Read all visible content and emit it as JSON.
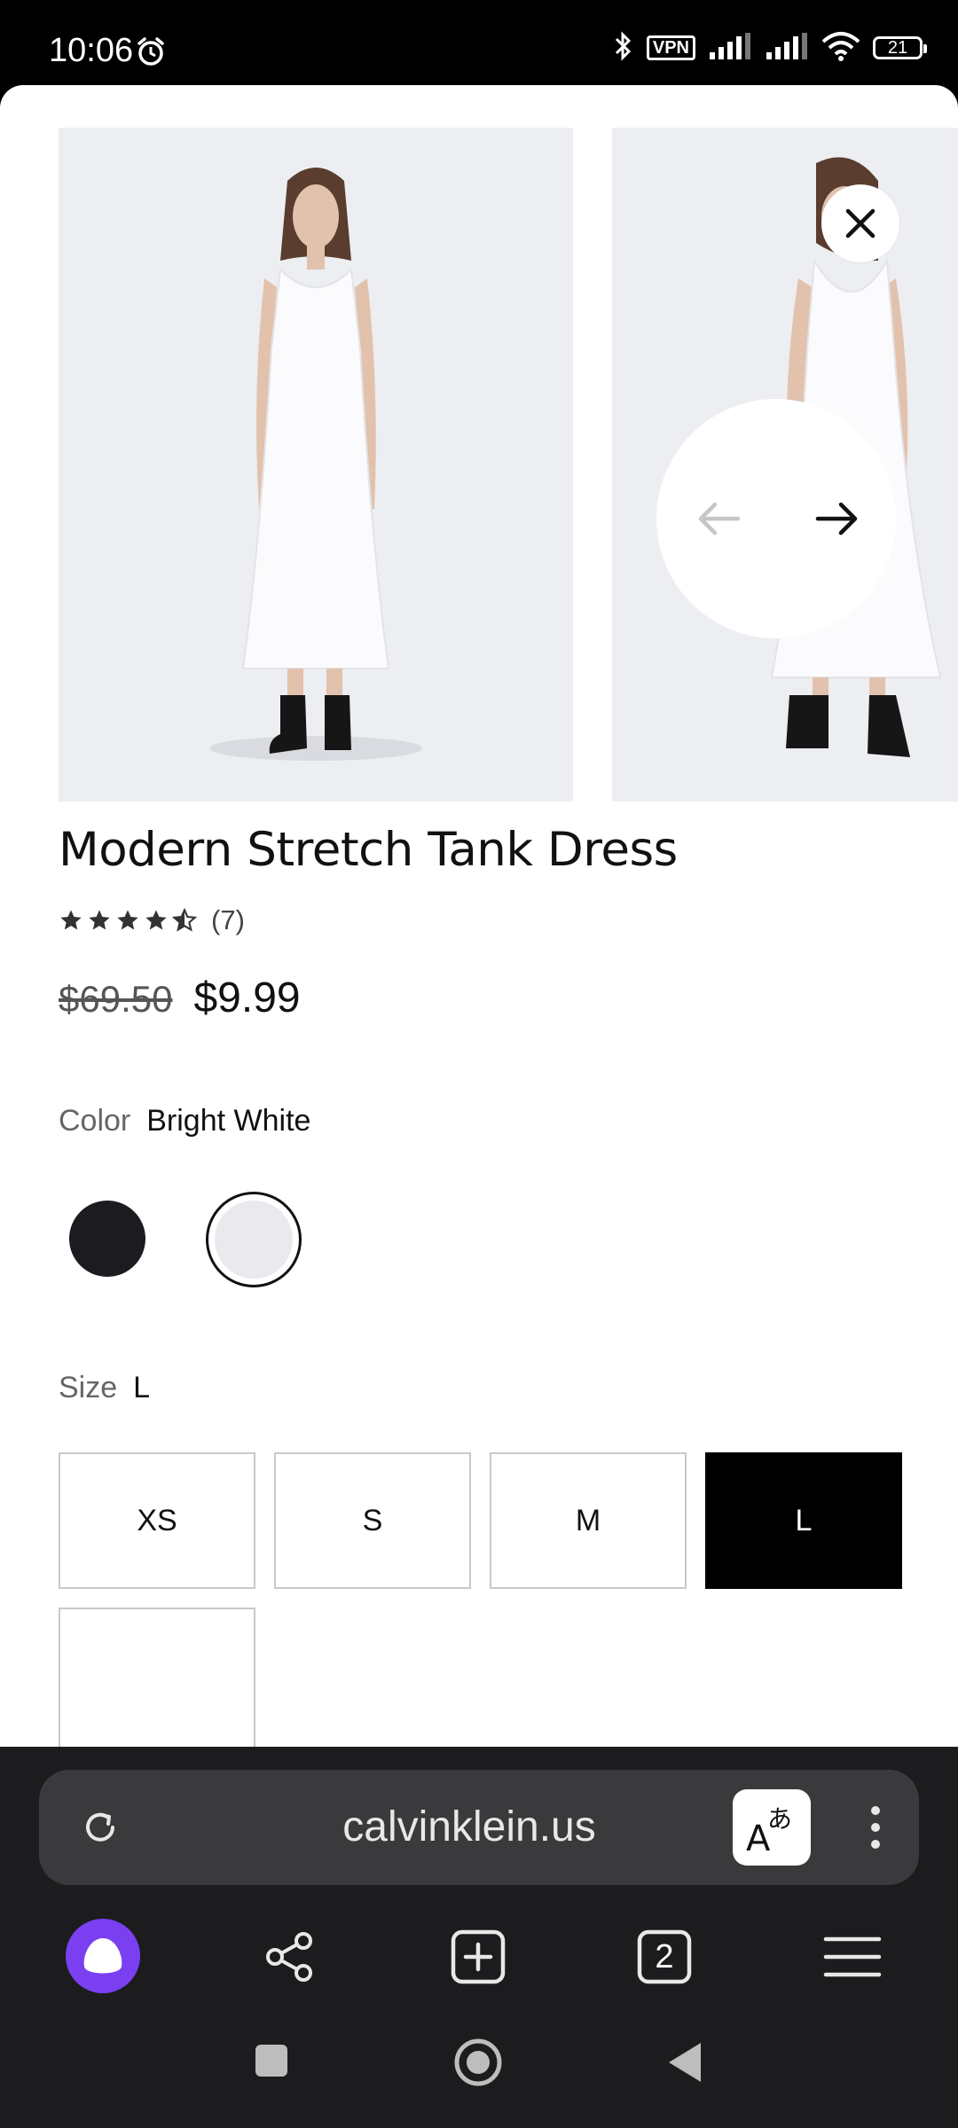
{
  "status_bar": {
    "time": "10:06",
    "vpn_label": "VPN",
    "battery": "21"
  },
  "product": {
    "title": "Modern Stretch Tank Dress",
    "rating": 4.5,
    "review_count": "(7)",
    "original_price": "$69.50",
    "sale_price": "$9.99",
    "color_label": "Color",
    "color_value": "Bright White",
    "colors": [
      {
        "name": "black",
        "hex": "#1c1b20",
        "selected": false
      },
      {
        "name": "white",
        "hex": "#e9e9ee",
        "selected": true
      }
    ],
    "size_label": "Size",
    "size_value": "L",
    "sizes": [
      "XS",
      "S",
      "M",
      "L"
    ],
    "selected_size": "L"
  },
  "browser": {
    "url": "calvinklein.us",
    "tab_count": "2"
  },
  "colors": {
    "accent_purple": "#7b3ff2",
    "browser_bg": "#1c1c1e",
    "urlbar_bg": "#3a3a3c"
  },
  "icons": [
    "alarm-icon",
    "bluetooth-icon",
    "signal-icon",
    "wifi-icon",
    "battery-icon",
    "close-icon",
    "arrow-left-icon",
    "arrow-right-icon",
    "star-icon",
    "reload-icon",
    "translate-icon",
    "more-vertical-icon",
    "alice-icon",
    "share-icon",
    "new-tab-icon",
    "tabs-icon",
    "menu-icon",
    "recent-apps-icon",
    "home-icon",
    "back-icon"
  ]
}
